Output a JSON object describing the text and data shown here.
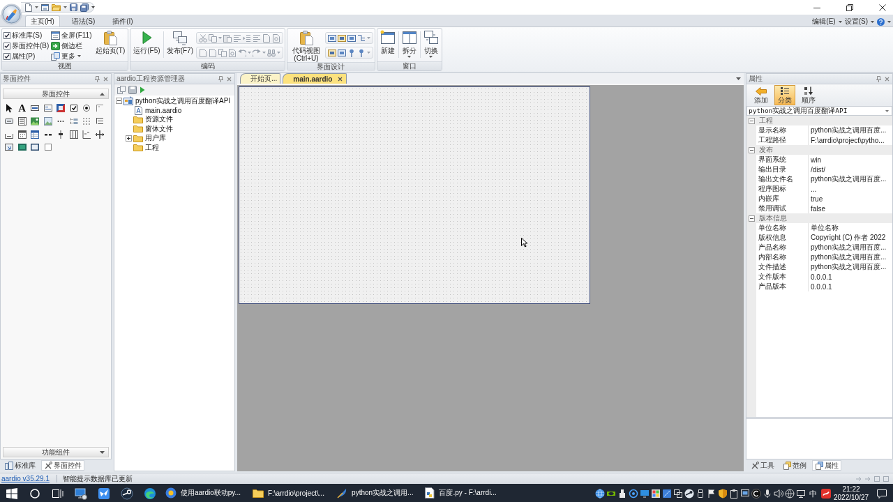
{
  "ribbon": {
    "tabs": [
      {
        "label": "主页(H)",
        "selected": true
      },
      {
        "label": "语法(S)",
        "selected": false
      },
      {
        "label": "插件(I)",
        "selected": false
      }
    ],
    "menus": [
      {
        "label": "编辑(E)"
      },
      {
        "label": "设置(S)"
      }
    ],
    "groups": [
      {
        "label": "视图",
        "columns": [
          {
            "kind": "checks",
            "items": [
              {
                "label": "标准库(S)",
                "checked": true
              },
              {
                "label": "界面控件(B)",
                "checked": true
              },
              {
                "label": "属性(P)",
                "checked": true
              }
            ]
          },
          {
            "kind": "small",
            "items": [
              {
                "label": "全屏(F11)",
                "dropdown": false
              },
              {
                "label": "侧边栏",
                "dropdown": false
              },
              {
                "label": "更多",
                "dropdown": true
              }
            ]
          },
          {
            "kind": "large",
            "label": "起始页(T)",
            "dropdown": false
          }
        ]
      },
      {
        "label": "编码",
        "columns": [
          {
            "kind": "large",
            "label": "运行(F5)",
            "dropdown": false
          },
          {
            "kind": "large",
            "label": "发布(F7)",
            "dropdown": false
          },
          {
            "kind": "tools"
          }
        ]
      },
      {
        "label": "界面设计",
        "columns": [
          {
            "kind": "large",
            "label": "代码视图 (Ctrl+U)",
            "dropdown": false
          },
          {
            "kind": "tools"
          }
        ]
      },
      {
        "label": "窗口",
        "columns": [
          {
            "kind": "large",
            "label": "新建",
            "dropdown": false
          },
          {
            "kind": "large",
            "label": "拆分",
            "dropdown": true
          },
          {
            "kind": "large",
            "label": "切换",
            "dropdown": true
          }
        ]
      }
    ]
  },
  "toolbox": {
    "title": "界面控件",
    "text_tool_glyph": "A",
    "sections": [
      {
        "label": "界面控件",
        "expanded": true
      },
      {
        "label": "功能组件",
        "expanded": false
      }
    ],
    "tabs": [
      {
        "label": "标准库",
        "selected": false
      },
      {
        "label": "界面控件",
        "selected": true
      }
    ]
  },
  "explorer": {
    "title": "aardio工程资源管理器",
    "tree": [
      {
        "label": "python实战之调用百度翻译API",
        "kind": "project",
        "expanded": true,
        "children": [
          {
            "label": "main.aardio",
            "kind": "file"
          },
          {
            "label": "资源文件",
            "kind": "folder"
          },
          {
            "label": "窗体文件",
            "kind": "folder"
          },
          {
            "label": "用户库",
            "kind": "folder",
            "expanded": false
          },
          {
            "label": "工程",
            "kind": "folder"
          }
        ]
      }
    ]
  },
  "editor": {
    "tabs": [
      {
        "label": "开始页...",
        "selected": false
      },
      {
        "label": "main.aardio",
        "selected": true
      }
    ]
  },
  "properties": {
    "title": "属性",
    "toolbar": [
      {
        "label": "添加",
        "selected": false
      },
      {
        "label": "分类",
        "selected": true
      },
      {
        "label": "顺序",
        "selected": false
      }
    ],
    "object": "python实战之调用百度翻译API",
    "categories": [
      {
        "label": "工程",
        "expanded": true,
        "rows": [
          {
            "name": "显示名称",
            "value": "python实战之调用百度..."
          },
          {
            "name": "工程路径",
            "value": "F:\\arrdio\\project\\pytho..."
          }
        ]
      },
      {
        "label": "发布",
        "expanded": true,
        "rows": [
          {
            "name": "界面系统",
            "value": "win"
          },
          {
            "name": "输出目录",
            "value": "/dist/"
          },
          {
            "name": "输出文件名",
            "value": "python实战之调用百度..."
          },
          {
            "name": "程序图标",
            "value": "..."
          },
          {
            "name": "内嵌库",
            "value": "true"
          },
          {
            "name": "禁用调试",
            "value": "false"
          }
        ]
      },
      {
        "label": "版本信息",
        "expanded": true,
        "rows": [
          {
            "name": "单位名称",
            "value": "单位名称"
          },
          {
            "name": "版权信息",
            "value": "Copyright (C) 作者 2022"
          },
          {
            "name": "产品名称",
            "value": "python实战之调用百度..."
          },
          {
            "name": "内部名称",
            "value": "python实战之调用百度..."
          },
          {
            "name": "文件描述",
            "value": "python实战之调用百度..."
          },
          {
            "name": "文件版本",
            "value": "0.0.0.1"
          },
          {
            "name": "产品版本",
            "value": "0.0.0.1"
          }
        ]
      }
    ],
    "tabs": [
      {
        "label": "工具",
        "selected": false
      },
      {
        "label": "范例",
        "selected": false
      },
      {
        "label": "属性",
        "selected": true
      }
    ]
  },
  "status_bar": {
    "version": "aardio v35.29.1",
    "message": "智能提示数据库已更新"
  },
  "taskbar": {
    "windows": [
      {
        "label": "使用aardio联动py..."
      },
      {
        "label": "F:\\arrdio\\project\\..."
      },
      {
        "label": "python实战之调用..."
      },
      {
        "label": "百度.py - F:\\arrdi..."
      }
    ],
    "ime": "中",
    "time": "21:22",
    "date": "2022/10/27"
  }
}
